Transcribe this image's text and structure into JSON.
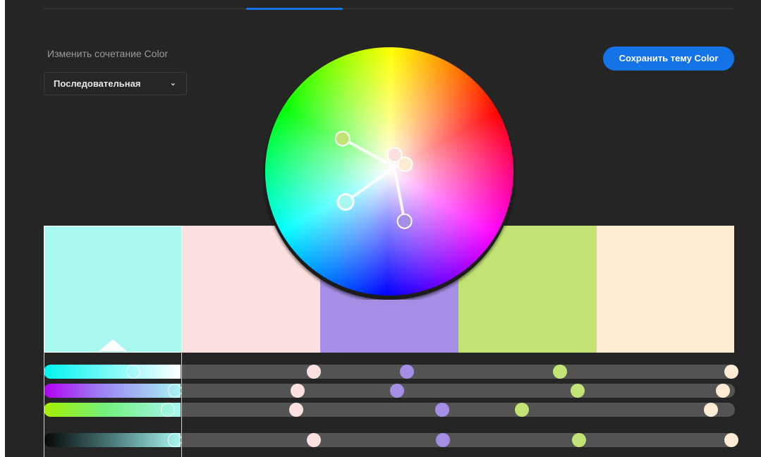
{
  "header": {
    "rule_label": "Изменить сочетание Color",
    "rule_value": "Последовательная",
    "save_label": "Сохранить тему Color"
  },
  "colors": {
    "accent": "#1473e6",
    "background": "#252525"
  },
  "swatches": [
    {
      "hex": "#a9f7f1",
      "selected": true
    },
    {
      "hex": "#fde1e0",
      "selected": false
    },
    {
      "hex": "#a58fe6",
      "selected": false
    },
    {
      "hex": "#c3e374",
      "selected": false
    },
    {
      "hex": "#fdebd4",
      "selected": false
    }
  ],
  "sliders": [
    {
      "id": "hue",
      "levels": [
        0.13,
        0.391,
        0.525,
        0.747,
        0.995
      ]
    },
    {
      "id": "saturation",
      "levels": [
        0.19,
        0.367,
        0.511,
        0.772,
        0.983
      ]
    },
    {
      "id": "brightness",
      "levels": [
        0.18,
        0.365,
        0.577,
        0.692,
        0.965
      ]
    },
    {
      "id": "value",
      "levels": [
        0.19,
        0.391,
        0.578,
        0.774,
        0.995
      ]
    }
  ],
  "wheel_markers": [
    {
      "hex": "#a9f7f1",
      "angle_deg": 235,
      "radius": 0.43
    },
    {
      "hex": "#fde1e0",
      "angle_deg": 18,
      "radius": 0.14
    },
    {
      "hex": "#a58fe6",
      "angle_deg": 163,
      "radius": 0.42
    },
    {
      "hex": "#c3e374",
      "angle_deg": 305,
      "radius": 0.46
    },
    {
      "hex": "#fdebd4",
      "angle_deg": 66,
      "radius": 0.14
    }
  ]
}
